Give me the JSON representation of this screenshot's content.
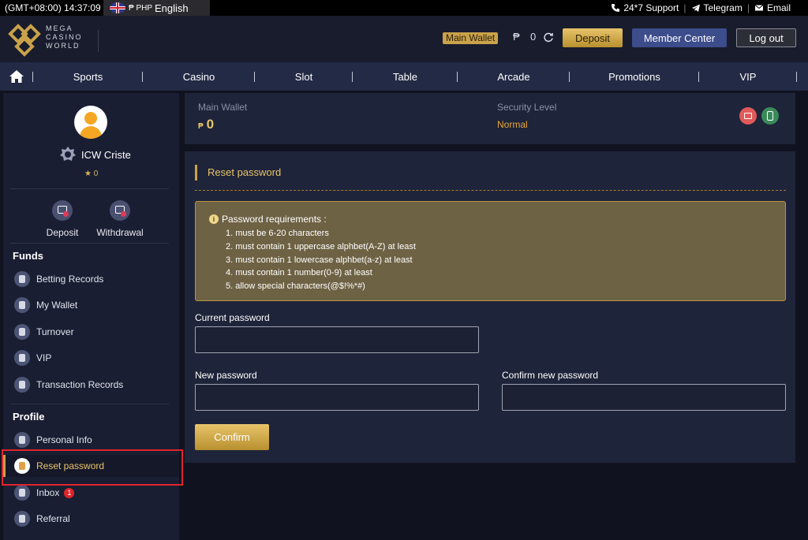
{
  "topbar": {
    "time": "(GMT+08:00) 14:37:09",
    "currency": "₱ PHP",
    "language": "English",
    "support": "24*7 Support",
    "telegram": "Telegram",
    "email": "Email"
  },
  "header": {
    "logo_lines": [
      "MEGA",
      "CASINO",
      "WORLD"
    ],
    "main_wallet_badge": "Main Wallet",
    "currency_symbol": "₱",
    "balance": "0",
    "deposit": "Deposit",
    "member_center": "Member Center",
    "logout": "Log out"
  },
  "nav": {
    "items": [
      "Sports",
      "Casino",
      "Slot",
      "Table",
      "Arcade",
      "Promotions",
      "VIP"
    ]
  },
  "sidebar": {
    "username": "ICW Criste",
    "stars": "★ 0",
    "quick": [
      "Deposit",
      "Withdrawal"
    ],
    "funds_title": "Funds",
    "funds": [
      "Betting Records",
      "My Wallet",
      "Turnover",
      "VIP",
      "Transaction Records"
    ],
    "profile_title": "Profile",
    "profile": [
      "Personal Info",
      "Reset password",
      "Inbox",
      "Referral"
    ],
    "inbox_count": "1"
  },
  "wallet_panel": {
    "main_wallet_label": "Main Wallet",
    "currency_symbol": "₱",
    "main_wallet_value": "0",
    "security_label": "Security Level",
    "security_value": "Normal"
  },
  "form": {
    "title": "Reset password",
    "req_title": "Password requirements :",
    "requirements": [
      "1. must be 6-20 characters",
      "2. must contain 1 uppercase alphbet(A-Z) at least",
      "3. must contain 1 lowercase alphbet(a-z) at least",
      "4. must contain 1 number(0-9) at least",
      "5. allow special characters(@$!%*#)"
    ],
    "current_label": "Current password",
    "new_label": "New password",
    "confirm_label": "Confirm new password",
    "current_value": "",
    "new_value": "",
    "confirm_value": "",
    "confirm_button": "Confirm"
  },
  "colors": {
    "accent_gold": "#c9a24a",
    "highlight_red": "#e0242b",
    "nav_bg": "#232a45",
    "panel_bg": "#1e2439"
  }
}
